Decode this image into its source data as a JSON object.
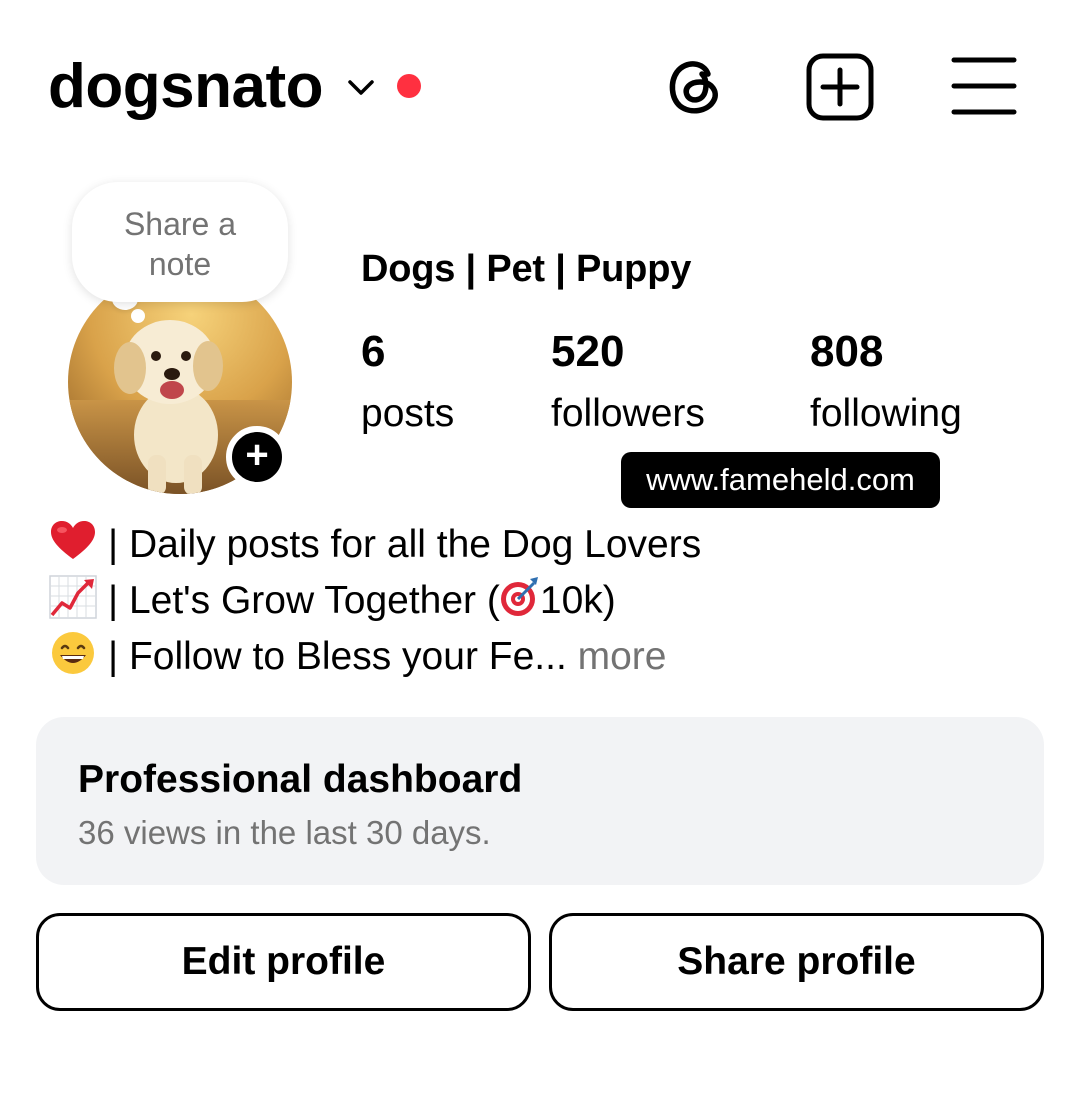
{
  "header": {
    "username": "dogsnato",
    "icons": [
      "chevron-down-icon",
      "notification-dot",
      "threads-icon",
      "new-post-icon",
      "menu-icon"
    ],
    "notification_dot_color": "#ff3040"
  },
  "note_bubble": {
    "text": "Share a note"
  },
  "profile": {
    "display_name": "Dogs | Pet | Puppy",
    "stats": {
      "posts": {
        "value": "6",
        "label": "posts"
      },
      "followers": {
        "value": "520",
        "label": "followers"
      },
      "following": {
        "value": "808",
        "label": "following"
      }
    }
  },
  "watermark": "www.fameheld.com",
  "bio": {
    "line1": "| Daily posts for all the Dog Lovers",
    "line2_before": "| Let's Grow Together (",
    "line2_after": "10k)",
    "line3": "| Follow to Bless your Fe...",
    "more": " more",
    "emojis": [
      "red-heart",
      "chart-increasing",
      "direct-hit",
      "grinning-face"
    ]
  },
  "dashboard": {
    "title": "Professional dashboard",
    "subtitle": "36 views in the last 30 days."
  },
  "buttons": {
    "edit": "Edit profile",
    "share": "Share profile"
  }
}
